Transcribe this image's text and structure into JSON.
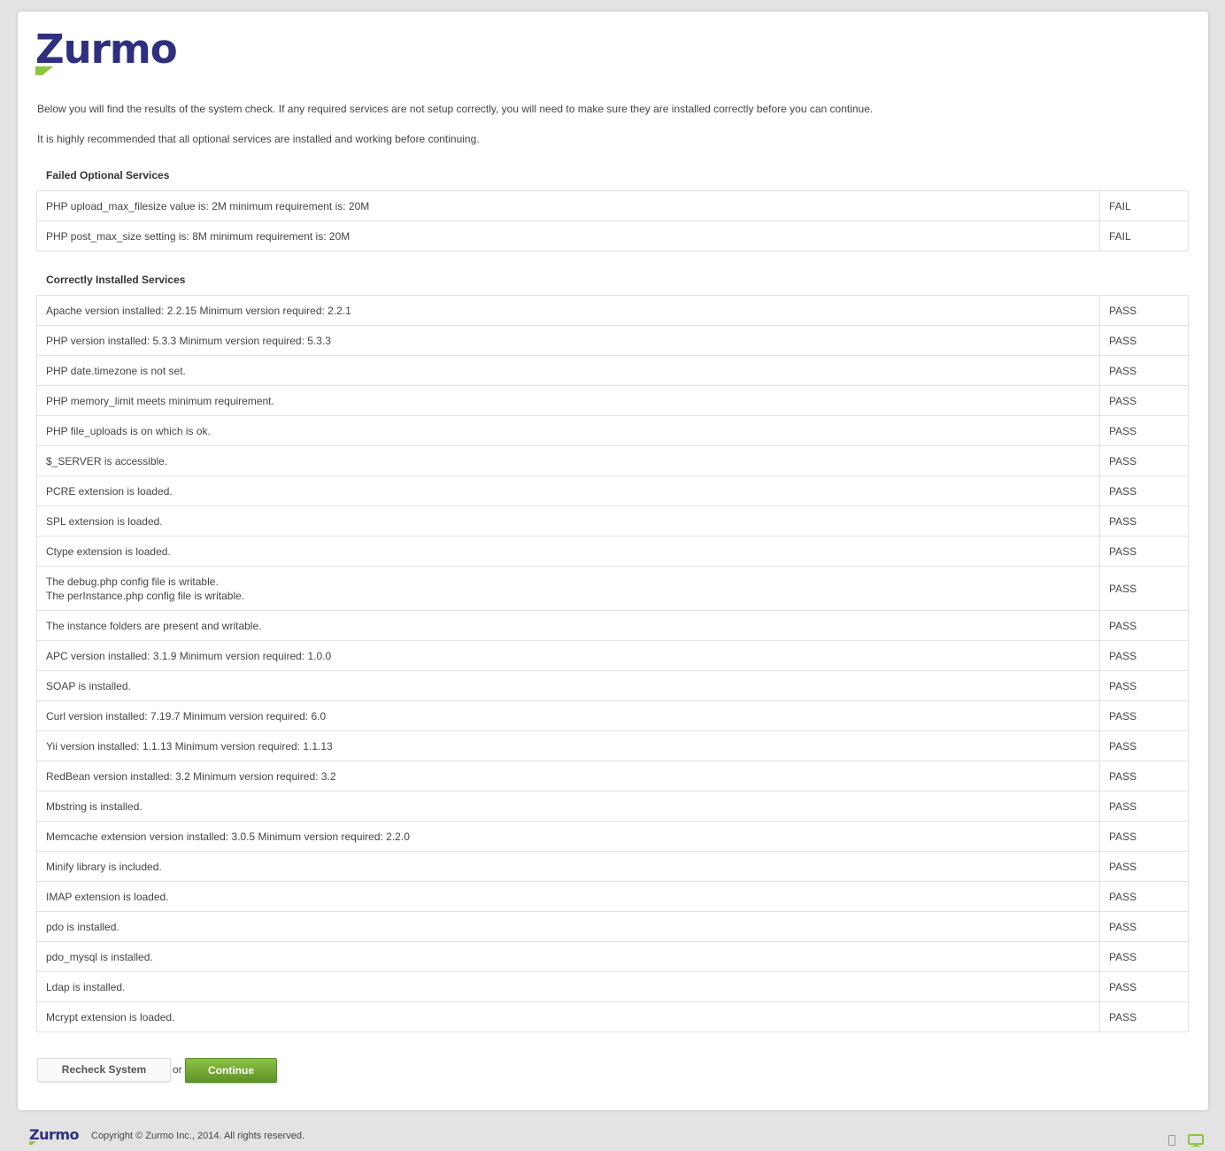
{
  "brand": {
    "name": "Zurmo",
    "accent": "#2e2f7f",
    "green": "#8cc63f"
  },
  "intro": {
    "line1": "Below you will find the results of the system check. If any required services are not setup correctly, you will need to make sure they are installed correctly before you can continue.",
    "line2": "It is highly recommended that all optional services are installed and working before continuing."
  },
  "failed_section": {
    "title": "Failed Optional Services",
    "rows": [
      {
        "label": "PHP upload_max_filesize value is: 2M minimum requirement is: 20M",
        "status": "FAIL"
      },
      {
        "label": "PHP post_max_size setting is: 8M minimum requirement is: 20M",
        "status": "FAIL"
      }
    ]
  },
  "passed_section": {
    "title": "Correctly Installed Services",
    "rows": [
      {
        "label": "Apache version installed: 2.2.15 Minimum version required: 2.2.1",
        "status": "PASS"
      },
      {
        "label": "PHP version installed: 5.3.3 Minimum version required: 5.3.3",
        "status": "PASS"
      },
      {
        "label": "PHP date.timezone is not set.",
        "status": "PASS"
      },
      {
        "label": "PHP memory_limit meets minimum requirement.",
        "status": "PASS"
      },
      {
        "label": "PHP file_uploads is on which is ok.",
        "status": "PASS"
      },
      {
        "label": "$_SERVER is accessible.",
        "status": "PASS"
      },
      {
        "label": "PCRE extension is loaded.",
        "status": "PASS"
      },
      {
        "label": "SPL extension is loaded.",
        "status": "PASS"
      },
      {
        "label": "Ctype extension is loaded.",
        "status": "PASS"
      },
      {
        "label": "The debug.php config file is writable.",
        "label2": "The perInstance.php config file is writable.",
        "status": "PASS"
      },
      {
        "label": "The instance folders are present and writable.",
        "status": "PASS"
      },
      {
        "label": "APC version installed: 3.1.9 Minimum version required: 1.0.0",
        "status": "PASS"
      },
      {
        "label": "SOAP is installed.",
        "status": "PASS"
      },
      {
        "label": "Curl version installed: 7.19.7 Minimum version required: 6.0",
        "status": "PASS"
      },
      {
        "label": "Yii version installed: 1.1.13 Minimum version required: 1.1.13",
        "status": "PASS"
      },
      {
        "label": "RedBean version installed: 3.2 Minimum version required: 3.2",
        "status": "PASS"
      },
      {
        "label": "Mbstring is installed.",
        "status": "PASS"
      },
      {
        "label": "Memcache extension version installed: 3.0.5 Minimum version required: 2.2.0",
        "status": "PASS"
      },
      {
        "label": "Minify library is included.",
        "status": "PASS"
      },
      {
        "label": "IMAP extension is loaded.",
        "status": "PASS"
      },
      {
        "label": "pdo is installed.",
        "status": "PASS"
      },
      {
        "label": "pdo_mysql is installed.",
        "status": "PASS"
      },
      {
        "label": "Ldap is installed.",
        "status": "PASS"
      },
      {
        "label": "Mcrypt extension is loaded.",
        "status": "PASS"
      }
    ]
  },
  "actions": {
    "recheck_label": "Recheck System",
    "or_text": "or",
    "continue_label": "Continue"
  },
  "footer": {
    "logo": "Zurmo",
    "copyright": "Copyright © Zurmo Inc., 2014. All rights reserved."
  },
  "icons": {
    "mobile": "mobile-view-icon",
    "desktop": "desktop-view-icon"
  }
}
